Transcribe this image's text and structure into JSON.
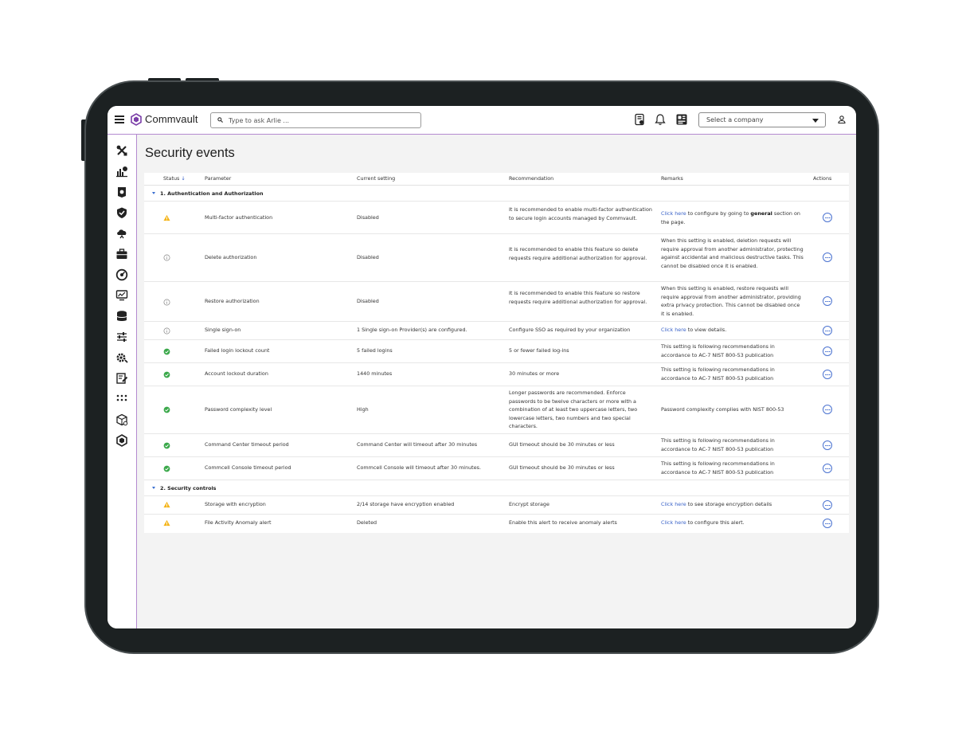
{
  "app": {
    "brand": "Commvault"
  },
  "search": {
    "placeholder": "Type to ask Arlie ..."
  },
  "company_select": {
    "value": "Select a company"
  },
  "page": {
    "title": "Security events"
  },
  "columns": {
    "status": "Status",
    "status_sort": "↓",
    "parameter": "Parameter",
    "current": "Current setting",
    "recommendation": "Recommendation",
    "remarks": "Remarks",
    "actions": "Actions"
  },
  "groups": [
    {
      "label": "1. Authentication and Authorization",
      "rows": [
        {
          "status": "warning",
          "parameter": "Multi-factor authentication",
          "current": "Disabled",
          "rec": "It is recommended to enable multi-factor authentication to secure login accounts managed by Commvault.",
          "link": "Click here",
          "rem_a": " to configure by going to ",
          "rem_b": "general",
          "rem_c": " section on the page."
        },
        {
          "status": "info",
          "parameter": "Delete authorization",
          "current": "Disabled",
          "rec": "It is recommended to enable this feature so delete requests require additional authorization for approval.",
          "rem": "When this setting is enabled, deletion requests will require approval from another administrator, protecting against accidental and malicious destructive tasks. This cannot be disabled once it is enabled."
        },
        {
          "status": "info",
          "parameter": "Restore authorization",
          "current": "Disabled",
          "rec": "It is recommended to enable this feature so restore requests require additional authorization for approval.",
          "rem": "When this setting is enabled, restore requests will require approval from another administrator, providing extra privacy protection. This cannot be disabled once it is enabled."
        },
        {
          "status": "info",
          "parameter": "Single sign-on",
          "current": "1 Single sign-on Provider(s) are configured.",
          "rec": "Configure SSO as required by your organization",
          "link": "Click here",
          "rem_a": " to view details."
        },
        {
          "status": "ok",
          "parameter": "Failed login lockout count",
          "current": "5 failed logins",
          "rec": "5 or fewer failed log-ins",
          "rem": "This setting is following recommendations in accordance to AC-7 NIST 800-53 publication"
        },
        {
          "status": "ok",
          "parameter": "Account lockout duration",
          "current": "1440 minutes",
          "rec": "30 minutes or more",
          "rem": "This setting is following recommendations in accordance to AC-7 NIST 800-53 publication"
        },
        {
          "status": "ok",
          "parameter": "Password complexity level",
          "current": "High",
          "rec": "Longer passwords are recommended. Enforce passwords to be twelve characters or more with a combination of at least two uppercase letters, two lowercase letters, two numbers and two special characters.",
          "rem": "Password complexity complies with NIST 800-53"
        },
        {
          "status": "ok",
          "parameter": "Command Center timeout period",
          "current": "Command Center will timeout after 30 minutes",
          "rec": "GUI timeout should be 30 minutes or less",
          "rem": "This setting is following recommendations in accordance to AC-7 NIST 800-53 publication"
        },
        {
          "status": "ok",
          "parameter": "Commcell Console timeout period",
          "current": "Commcell Console will timeout after 30 minutes.",
          "rec": "GUI timeout should be 30 minutes or less",
          "rem": "This setting is following recommendations in accordance to AC-7 NIST 800-53 publication"
        }
      ]
    },
    {
      "label": "2. Security controls",
      "rows": [
        {
          "status": "warning",
          "parameter": "Storage with encryption",
          "current": "2/14 storage have encryption enabled",
          "rec": "Encrypt storage",
          "link": "Click here",
          "rem_a": " to see storage encryption details"
        },
        {
          "status": "warning",
          "parameter": "File Activity Anomaly alert",
          "current": "Deleted",
          "rec": "Enable this alert to receive anomaly alerts",
          "link": "Click here",
          "rem_a": " to configure this alert."
        }
      ]
    }
  ],
  "colors": {
    "warning": "#f5b51b",
    "ok": "#3aa84a",
    "info": "#8a8a8a",
    "link": "#3a63c8",
    "accent": "#b48ad0"
  },
  "icons": {
    "topbar": [
      "menu-icon",
      "commvault-logo-icon",
      "search-icon",
      "report-icon",
      "bell-icon",
      "dashboard-icon",
      "chevron-down-icon",
      "user-icon"
    ],
    "nav": [
      "tools-icon",
      "reports-icon",
      "security-badge-icon",
      "shield-icon",
      "cloud-icon",
      "briefcase-icon",
      "gauge-icon",
      "monitor-icon",
      "storage-icon",
      "sliders-icon",
      "gear-icon",
      "edit-icon",
      "apps-icon",
      "package-icon",
      "commvault-hex-icon"
    ]
  }
}
